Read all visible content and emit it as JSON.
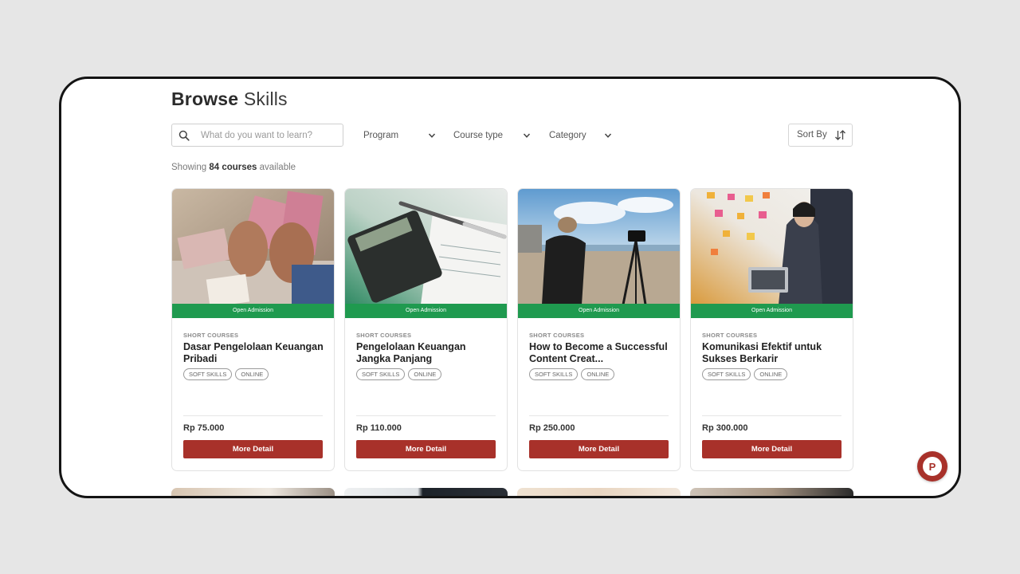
{
  "page": {
    "title_bold": "Browse",
    "title_light": "Skills"
  },
  "search": {
    "placeholder": "What do you want to learn?",
    "icon": "search-icon"
  },
  "filters": [
    {
      "label": "Program",
      "icon": "chevron-down-icon"
    },
    {
      "label": "Course type",
      "icon": "chevron-down-icon"
    },
    {
      "label": "Category",
      "icon": "chevron-down-icon"
    }
  ],
  "sort": {
    "label": "Sort By",
    "icon": "sort-arrows-icon"
  },
  "results": {
    "prefix": "Showing",
    "count": "84 courses",
    "suffix": "available"
  },
  "courses": [
    {
      "badge": "Open Admission",
      "category": "SHORT COURSES",
      "title": "Dasar Pengelolaan Keuangan Pribadi",
      "tags": [
        "SOFT SKILLS",
        "ONLINE"
      ],
      "price": "Rp 75.000",
      "button": "More Detail",
      "image": "hands-counting-money-photo"
    },
    {
      "badge": "Open Admission",
      "category": "SHORT COURSES",
      "title": "Pengelolaan Keuangan Jangka Panjang",
      "tags": [
        "SOFT SKILLS",
        "ONLINE"
      ],
      "price": "Rp 110.000",
      "button": "More Detail",
      "image": "calculator-pen-documents-photo"
    },
    {
      "badge": "Open Admission",
      "category": "SHORT COURSES",
      "title": "How to Become a Successful Content Creat...",
      "tags": [
        "SOFT SKILLS",
        "ONLINE"
      ],
      "price": "Rp 250.000",
      "button": "More Detail",
      "image": "content-creator-beach-camera-photo"
    },
    {
      "badge": "Open Admission",
      "category": "SHORT COURSES",
      "title": "Komunikasi Efektif untuk Sukses Berkarir",
      "tags": [
        "SOFT SKILLS",
        "ONLINE"
      ],
      "price": "Rp 300.000",
      "button": "More Detail",
      "image": "presenter-sticky-notes-photo"
    }
  ],
  "chat": {
    "icon": "chat-logo-icon",
    "letter": "P"
  },
  "colors": {
    "primary": "#a8312a",
    "admission_green": "#1f9a4f",
    "background": "#e6e6e6"
  }
}
